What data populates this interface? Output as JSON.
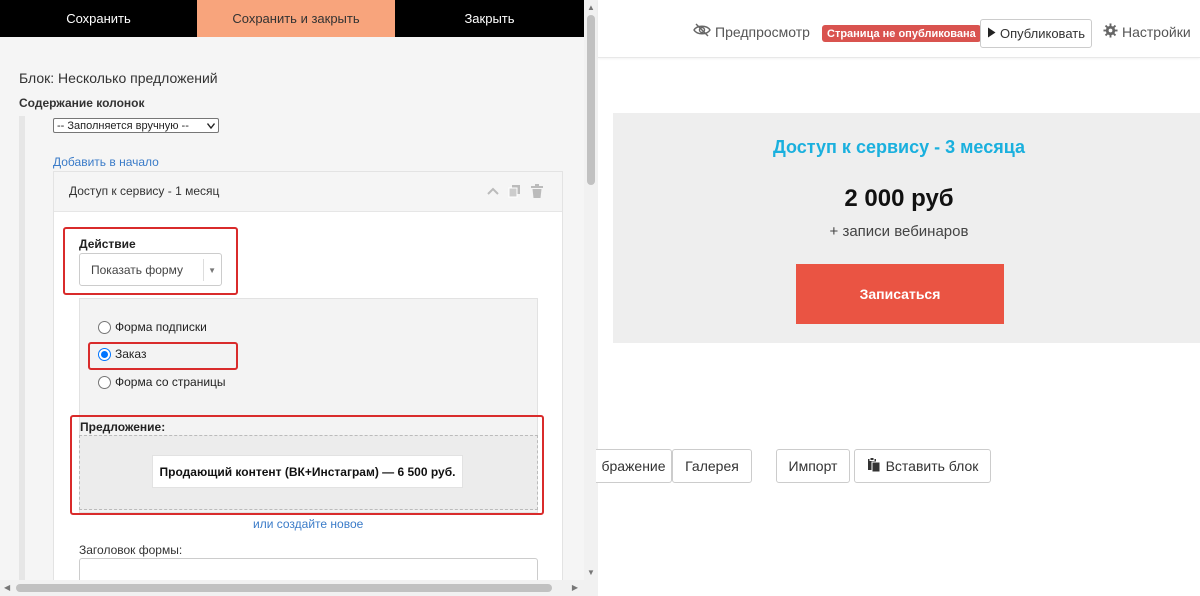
{
  "toolbar": {
    "save": "Сохранить",
    "save_close": "Сохранить и закрыть",
    "close": "Закрыть"
  },
  "editor": {
    "block_title": "Блок: Несколько предложений",
    "columns_label": "Содержание колонок",
    "fill_mode": "-- Заполняется вручную --",
    "add_to_start": "Добавить в начало",
    "card_title": "Доступ к сервису - 1 месяц",
    "action_label": "Действие",
    "action_value": "Показать форму",
    "radios": [
      {
        "label": "Форма подписки",
        "checked": false
      },
      {
        "label": "Заказ",
        "checked": true
      },
      {
        "label": "Форма со страницы",
        "checked": false
      }
    ],
    "offer_label": "Предложение:",
    "offer_value": "Продающий контент (ВК+Инстаграм) — 6 500 руб.",
    "create_new": "или создайте новое",
    "form_title_label": "Заголовок формы:"
  },
  "header": {
    "preview": "Предпросмотр",
    "status_badge": "Страница не опубликована",
    "publish": "Опубликовать",
    "settings": "Настройки"
  },
  "offer_block": {
    "title": "Доступ к сервису - 3 месяца",
    "price": "2 000 руб",
    "subtitle": "+ записи вебинаров",
    "button": "Записаться"
  },
  "bottom_buttons": {
    "image_partial": "бражение",
    "gallery": "Галерея",
    "import": "Импорт",
    "paste_block": "Вставить блок"
  },
  "colors": {
    "accent_orange": "#f8a47c",
    "title_blue": "#1ab0de",
    "cta_red": "#ea5443",
    "badge_red": "#d9534f",
    "highlight_red": "#d92b2b"
  }
}
